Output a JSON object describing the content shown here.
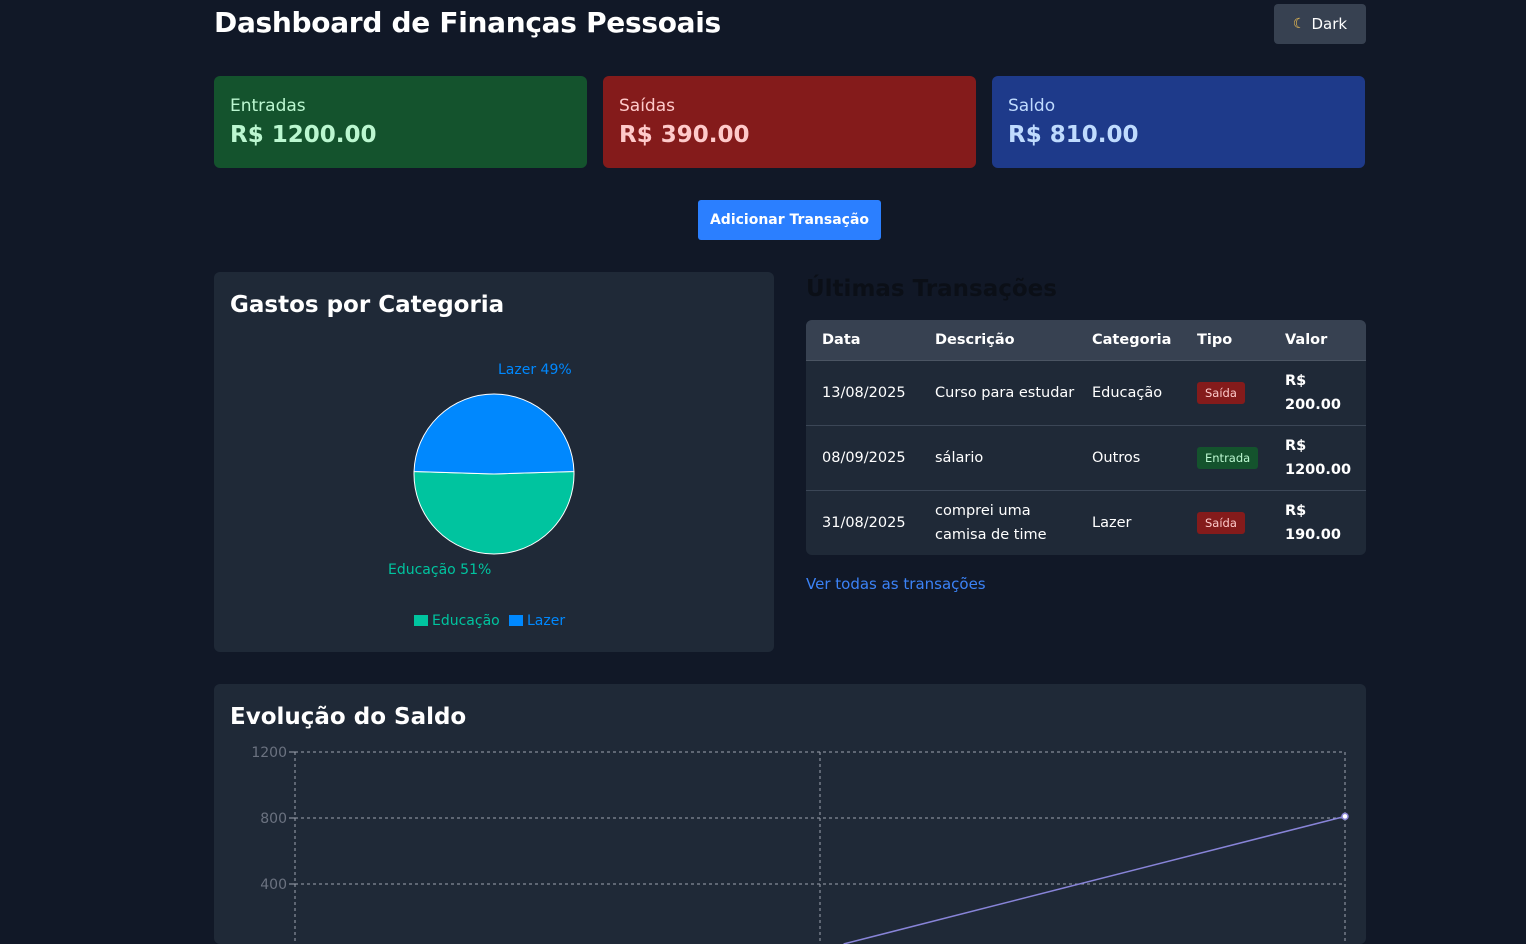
{
  "header": {
    "title": "Dashboard de Finanças Pessoais",
    "theme_label": "Dark",
    "theme_icon": "moon-icon"
  },
  "summary": [
    {
      "label": "Entradas",
      "value": "R$ 1200.00",
      "color": "#14532d"
    },
    {
      "label": "Saídas",
      "value": "R$ 390.00",
      "color": "#841b1b"
    },
    {
      "label": "Saldo",
      "value": "R$ 810.00",
      "color": "#1e3a8a"
    }
  ],
  "actions": {
    "add_label": "Adicionar Transação"
  },
  "pie": {
    "title": "Gastos por Categoria",
    "chart_data": {
      "type": "pie",
      "slices": [
        {
          "name": "Educação",
          "value": 51,
          "label": "Educação 51%",
          "color": "#00c49f"
        },
        {
          "name": "Lazer",
          "value": 49,
          "label": "Lazer 49%",
          "color": "#0088fe"
        }
      ],
      "legend": "bottom"
    }
  },
  "transactions": {
    "title": "Últimas Transações",
    "columns": [
      "Data",
      "Descrição",
      "Categoria",
      "Tipo",
      "Valor"
    ],
    "rows": [
      {
        "data": "13/08/2025",
        "descricao": "Curso para estudar",
        "categoria": "Educação",
        "tipo": "Saída",
        "valor_prefix": "R$",
        "valor": "200.00"
      },
      {
        "data": "08/09/2025",
        "descricao": "sálario",
        "categoria": "Outros",
        "tipo": "Entrada",
        "valor_prefix": "R$",
        "valor": "1200.00"
      },
      {
        "data": "31/08/2025",
        "descricao": "comprei uma camisa de time",
        "categoria": "Lazer",
        "tipo": "Saída",
        "valor_prefix": "R$",
        "valor": "190.00"
      }
    ],
    "view_all": "Ver todas as transações"
  },
  "balance": {
    "title": "Evolução do Saldo",
    "chart_data": {
      "type": "line",
      "y_ticks": [
        1200,
        800,
        400
      ],
      "ylim": [
        0,
        1200
      ],
      "grid": true,
      "series": [
        {
          "points": [
            [
              0.5,
              0
            ],
            [
              1,
              810
            ]
          ],
          "color": "#8884d8"
        }
      ]
    }
  }
}
